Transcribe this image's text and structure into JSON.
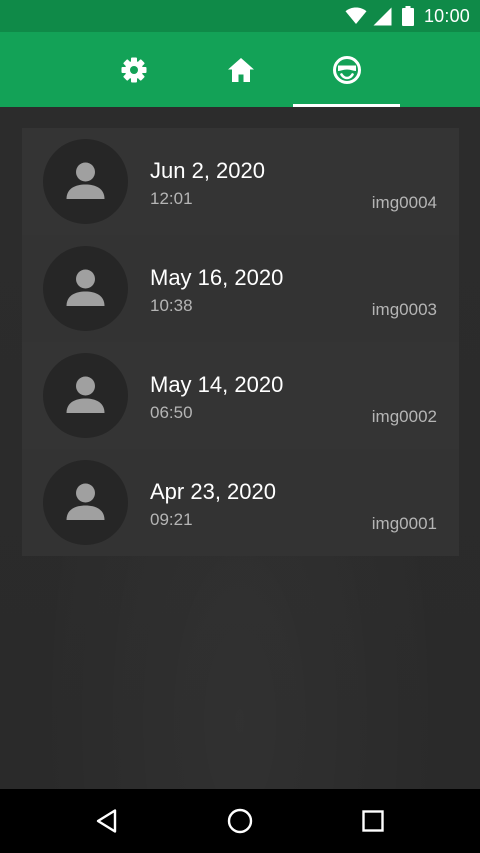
{
  "status_bar": {
    "time": "10:00",
    "icons": [
      "wifi-icon",
      "signal-icon",
      "battery-icon"
    ]
  },
  "tabs": [
    {
      "name": "settings",
      "icon": "gear-icon",
      "selected": false
    },
    {
      "name": "home",
      "icon": "home-icon",
      "selected": false
    },
    {
      "name": "profile",
      "icon": "masked-face-icon",
      "selected": true
    }
  ],
  "entries": [
    {
      "date": "Jun 2, 2020",
      "time": "12:01",
      "image": "img0004",
      "avatar_icon": "person-icon"
    },
    {
      "date": "May 16, 2020",
      "time": "10:38",
      "image": "img0003",
      "avatar_icon": "person-icon"
    },
    {
      "date": "May 14, 2020",
      "time": "06:50",
      "image": "img0002",
      "avatar_icon": "person-icon"
    },
    {
      "date": "Apr 23, 2020",
      "time": "09:21",
      "image": "img0001",
      "avatar_icon": "person-icon"
    }
  ],
  "nav_bar": {
    "buttons": [
      "back-icon",
      "home-circle-icon",
      "recents-icon"
    ]
  },
  "colors": {
    "status_bar": "#0f8a48",
    "app_bar": "#13a257",
    "background": "#2a2a2a",
    "list_background": "#333333",
    "avatar_background": "#262626",
    "avatar_glyph": "#a0a0a0",
    "primary_text": "#ffffff",
    "secondary_text": "#b5b5b5",
    "nav_bar": "#000000"
  }
}
